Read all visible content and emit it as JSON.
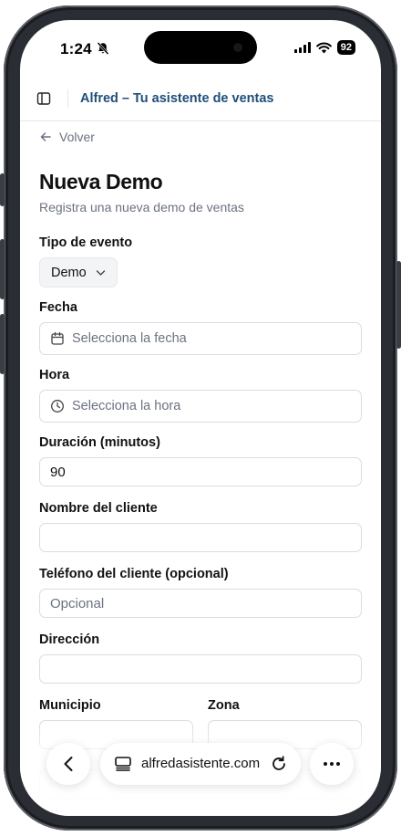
{
  "status_bar": {
    "time": "1:24",
    "battery": "92"
  },
  "header": {
    "title": "Alfred – Tu asistente de ventas"
  },
  "back": {
    "label": "Volver"
  },
  "page": {
    "title": "Nueva Demo",
    "subtitle": "Registra una nueva demo de ventas"
  },
  "form": {
    "event_type": {
      "label": "Tipo de evento",
      "value": "Demo"
    },
    "date": {
      "label": "Fecha",
      "placeholder": "Selecciona la fecha"
    },
    "time": {
      "label": "Hora",
      "placeholder": "Selecciona la hora"
    },
    "duration": {
      "label": "Duración (minutos)",
      "value": "90"
    },
    "client_name": {
      "label": "Nombre del cliente",
      "value": ""
    },
    "client_phone": {
      "label": "Teléfono del cliente (opcional)",
      "placeholder": "Opcional"
    },
    "address": {
      "label": "Dirección",
      "value": ""
    },
    "municipality": {
      "label": "Municipio",
      "value": ""
    },
    "zone": {
      "label": "Zona",
      "value": ""
    }
  },
  "browser": {
    "url": "alfredasistente.com"
  },
  "colors": {
    "title_blue": "#1f4e79",
    "muted": "#6b7280",
    "border": "#d9dce1"
  }
}
